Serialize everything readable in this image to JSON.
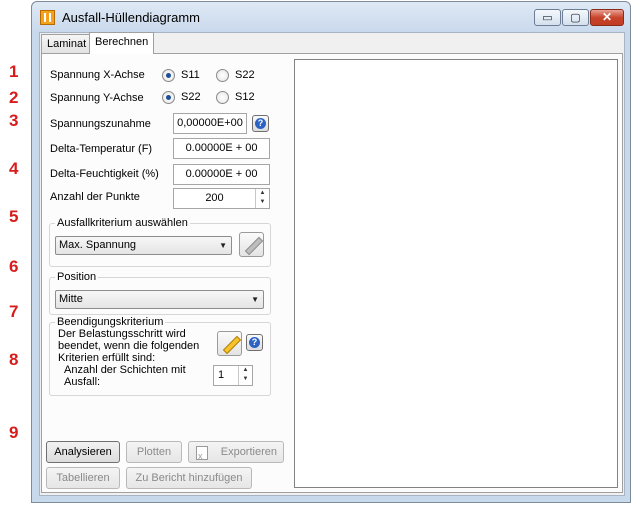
{
  "step_numbers": [
    "1",
    "2",
    "3",
    "4",
    "5",
    "6",
    "7",
    "8",
    "9"
  ],
  "window": {
    "title": "Ausfall-Hüllendiagramm",
    "controls": {
      "minimize": "▭",
      "maximize": "▢",
      "close": "✕"
    }
  },
  "tabs": [
    {
      "label": "Laminat",
      "active": false
    },
    {
      "label": "Berechnen",
      "active": true
    }
  ],
  "form": {
    "x_axis": {
      "label": "Spannung X-Achse",
      "options": [
        "S11",
        "S22"
      ],
      "selected": "S11"
    },
    "y_axis": {
      "label": "Spannung Y-Achse",
      "options": [
        "S22",
        "S12"
      ],
      "selected": "S22"
    },
    "stress_increment": {
      "label": "Spannungszunahme",
      "value": "0,00000E+00"
    },
    "delta_temperature": {
      "label": "Delta-Temperatur (F)",
      "value": "0.00000E + 00"
    },
    "delta_moisture": {
      "label": "Delta-Feuchtigkeit (%)",
      "value": "0.00000E + 00"
    },
    "num_points": {
      "label": "Anzahl der Punkte",
      "value": "200"
    },
    "failure_criterion": {
      "group_title": "Ausfallkriterium auswählen",
      "selected": "Max. Spannung"
    },
    "position": {
      "group_title": "Position",
      "selected": "Mitte"
    },
    "termination": {
      "group_title": "Beendigungskriterium",
      "description_lines": [
        "Der Belastungsschritt wird",
        "beendet, wenn die folgenden",
        "Kriterien erfüllt sind:"
      ],
      "failed_layers_lines": [
        "Anzahl der Schichten mit",
        "Ausfall:"
      ],
      "failed_layers_value": "1"
    }
  },
  "buttons": {
    "analyze": "Analysieren",
    "plot": "Plotten",
    "export": "Exportieren",
    "tabulate": "Tabellieren",
    "add_to_report": "Zu Bericht hinzufügen"
  },
  "icons": {
    "help": "help-icon",
    "edit": "pencil-icon",
    "spin_up": "▲",
    "spin_down": "▼",
    "dropdown": "▼",
    "app": "app-icon",
    "export": "spreadsheet-icon"
  },
  "colors": {
    "step_number": "#d81c1c",
    "radio_selected": "#1d4f96",
    "help_icon": "#2a63c4"
  }
}
